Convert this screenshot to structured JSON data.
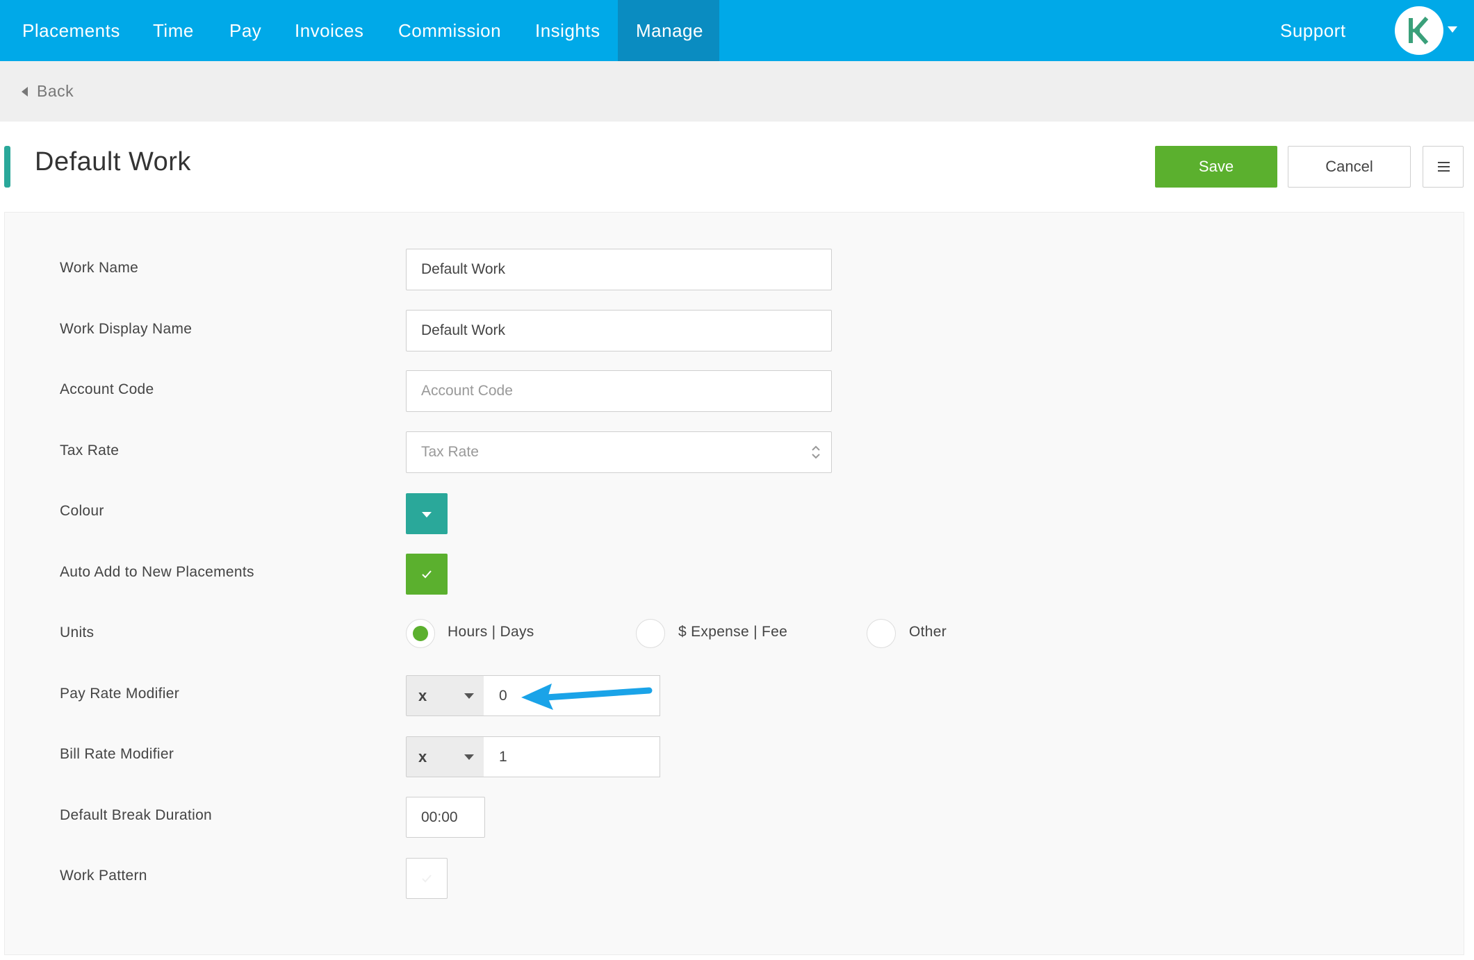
{
  "nav": {
    "items": [
      {
        "label": "Placements"
      },
      {
        "label": "Time"
      },
      {
        "label": "Pay"
      },
      {
        "label": "Invoices"
      },
      {
        "label": "Commission"
      },
      {
        "label": "Insights"
      },
      {
        "label": "Manage",
        "active": true
      }
    ],
    "support_label": "Support",
    "avatar_icon": "k-logo-icon",
    "brand_color": "#00a9e8"
  },
  "back": {
    "label": "Back"
  },
  "page": {
    "title": "Default Work",
    "save_label": "Save",
    "cancel_label": "Cancel"
  },
  "form": {
    "work_name": {
      "label": "Work Name",
      "value": "Default Work"
    },
    "work_display_name": {
      "label": "Work Display Name",
      "value": "Default Work"
    },
    "account_code": {
      "label": "Account Code",
      "placeholder": "Account Code",
      "value": ""
    },
    "tax_rate": {
      "label": "Tax Rate",
      "placeholder": "Tax Rate",
      "value": ""
    },
    "colour": {
      "label": "Colour",
      "value": "#2aa89a"
    },
    "auto_add": {
      "label": "Auto Add to New Placements",
      "checked": true
    },
    "units": {
      "label": "Units",
      "options": [
        "Hours | Days",
        "$ Expense | Fee",
        "Other"
      ],
      "selected": "Hours | Days"
    },
    "pay_rate_modifier": {
      "label": "Pay Rate Modifier",
      "operator": "x",
      "value": "0"
    },
    "bill_rate_modifier": {
      "label": "Bill Rate Modifier",
      "operator": "x",
      "value": "1"
    },
    "default_break_duration": {
      "label": "Default Break Duration",
      "value": "00:00"
    },
    "work_pattern": {
      "label": "Work Pattern",
      "checked": false
    }
  }
}
